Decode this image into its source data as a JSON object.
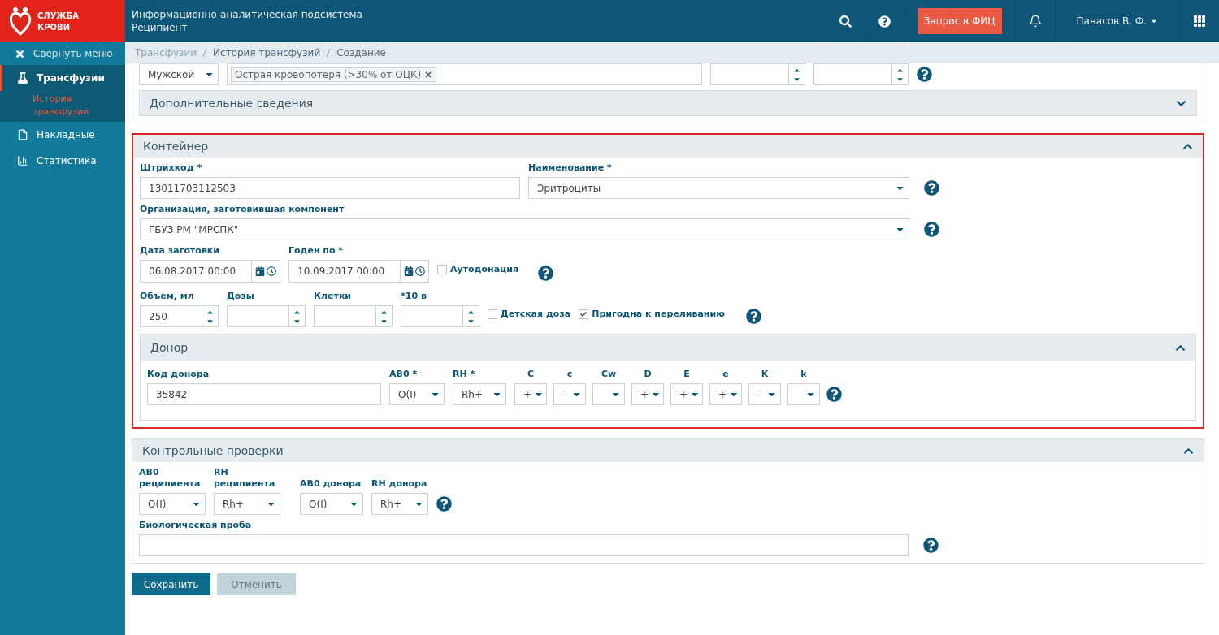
{
  "header": {
    "title": "Информационно-аналитическая подсистема",
    "subtitle": "Реципиент",
    "request_button": "Запрос в ФИЦ",
    "user": "Панасов В. Ф."
  },
  "sidebar": {
    "logo": [
      "СЛУЖБА",
      "КРОВИ"
    ],
    "collapse": "Свернуть меню",
    "items": [
      {
        "label": "Трансфузии",
        "kind": "flask",
        "selected": true,
        "children": [
          {
            "label": "История трансфузий",
            "selected": true
          }
        ]
      },
      {
        "label": "Накладные",
        "kind": "document",
        "selected": false
      },
      {
        "label": "Статистика",
        "kind": "chart",
        "selected": false
      }
    ]
  },
  "breadcrumbs": [
    {
      "label": "Трансфузии",
      "kind": "faded"
    },
    {
      "label": "История трансфузий",
      "kind": "link"
    },
    {
      "label": "Создание",
      "kind": "current"
    }
  ],
  "recipient": {
    "gender": "Мужской",
    "diagnosis_tag": "Острая кровопотеря (>30% от ОЦК)",
    "additional": {
      "title": "Дополнительные сведения",
      "expanded": false
    }
  },
  "container": {
    "title": "Контейнер",
    "expanded": true,
    "barcode": {
      "label": "Штрихкод *",
      "value": "13011703112503"
    },
    "name": {
      "label": "Наименование *",
      "value": "Эритроциты"
    },
    "organization": {
      "label": "Организация, заготовившая компонент",
      "value": "ГБУЗ РМ \"МРСПК\""
    },
    "dates": [
      {
        "label": "Дата заготовки",
        "value": "06.08.2017 00:00"
      },
      {
        "label": "Годен по *",
        "value": "10.09.2017 00:00"
      }
    ],
    "autodonation": {
      "label": "Аутодонация",
      "checked": false
    },
    "numbers": [
      {
        "label": "Объем, мл",
        "value": "250"
      },
      {
        "label": "Дозы"
      },
      {
        "label": "Клетки"
      },
      {
        "label": "*10 в"
      }
    ],
    "flags": [
      {
        "label": "Детская доза",
        "checked": false
      },
      {
        "label": "Пригодна к переливанию",
        "checked": true
      }
    ],
    "donor": {
      "title": "Донор",
      "expanded": true,
      "code": {
        "label": "Код донора",
        "value": "35842"
      },
      "groups": [
        {
          "label": "AB0 *",
          "value": "O(I)"
        },
        {
          "label": "RH *",
          "value": "Rh+"
        }
      ],
      "antigens": [
        {
          "label": "C",
          "value": "+"
        },
        {
          "label": "c",
          "value": "-"
        },
        {
          "label": "Cw"
        },
        {
          "label": "D",
          "value": "+"
        },
        {
          "label": "E",
          "value": "+"
        },
        {
          "label": "e",
          "value": "+"
        },
        {
          "label": "K",
          "value": "-"
        },
        {
          "label": "k"
        }
      ]
    }
  },
  "checks": {
    "title": "Контрольные проверки",
    "expanded": true,
    "selects": [
      {
        "label": "AB0 реципиента",
        "value": "O(I)"
      },
      {
        "label": "RH реципиента",
        "value": "Rh+"
      },
      {
        "label": "AB0 донора",
        "value": "O(I)"
      },
      {
        "label": "RH донора",
        "value": "Rh+"
      }
    ],
    "bio_test": {
      "label": "Биологическая проба"
    }
  },
  "actions": {
    "save": "Сохранить",
    "cancel": {
      "label": "Отменить",
      "disabled": true
    }
  }
}
